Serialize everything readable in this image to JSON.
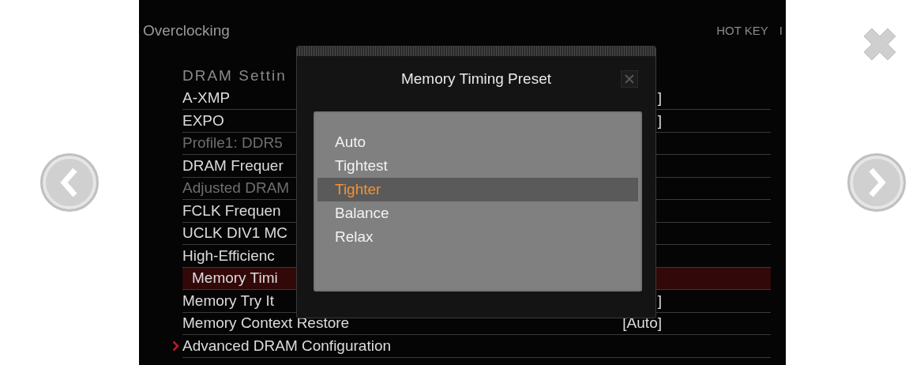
{
  "viewer": {
    "screen": {
      "title": "Overclocking",
      "hotkey": "HOT KEY",
      "hotkey_extra": "I",
      "rows": [
        {
          "kind": "header",
          "label": "DRAM Settin"
        },
        {
          "kind": "setting",
          "label": "A-XMP",
          "value": "]",
          "disabled": false,
          "selected": false
        },
        {
          "kind": "setting",
          "label": "EXPO",
          "value": "]",
          "disabled": false,
          "selected": false
        },
        {
          "kind": "setting",
          "label": "Profile1: DDR5",
          "disabled": true,
          "selected": false
        },
        {
          "kind": "setting",
          "label": "DRAM Frequer",
          "disabled": false,
          "selected": false
        },
        {
          "kind": "setting",
          "label": "Adjusted DRAM",
          "disabled": true,
          "selected": false
        },
        {
          "kind": "setting",
          "label": "FCLK Frequen",
          "disabled": false,
          "selected": false
        },
        {
          "kind": "setting",
          "label": "UCLK DIV1 MC",
          "disabled": false,
          "selected": false
        },
        {
          "kind": "setting",
          "label": "High-Efficienc",
          "disabled": false,
          "selected": false
        },
        {
          "kind": "setting",
          "label": "Memory Timi",
          "disabled": false,
          "selected": true
        },
        {
          "kind": "setting",
          "label": "Memory Try It",
          "value": "]",
          "disabled": false,
          "selected": false
        },
        {
          "kind": "setting",
          "label": "Memory Context Restore",
          "value": "[Auto]",
          "disabled": false,
          "selected": false
        },
        {
          "kind": "submenu",
          "label": "Advanced DRAM Configuration",
          "disabled": false,
          "selected": false
        }
      ],
      "dialog": {
        "title": "Memory Timing Preset",
        "options": [
          {
            "label": "Auto",
            "selected": false
          },
          {
            "label": "Tightest",
            "selected": false
          },
          {
            "label": "Tighter",
            "selected": true
          },
          {
            "label": "Balance",
            "selected": false
          },
          {
            "label": "Relax",
            "selected": false
          }
        ]
      }
    }
  }
}
